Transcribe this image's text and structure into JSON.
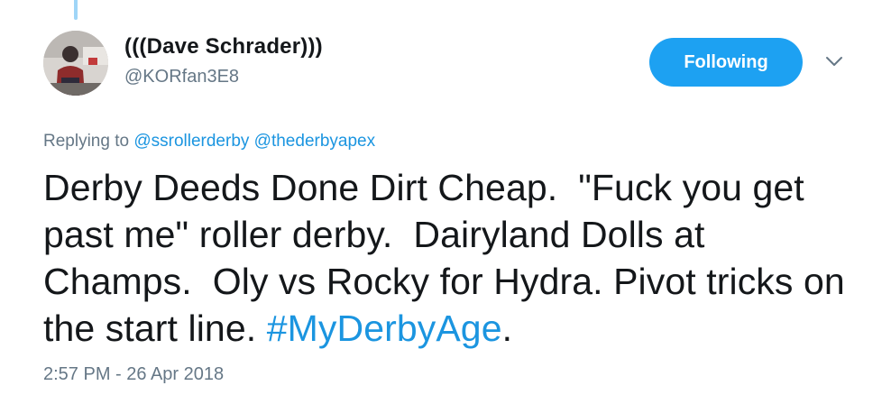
{
  "author": {
    "display_name": "(((Dave Schrader)))",
    "handle": "@KORfan3E8"
  },
  "follow_button": {
    "label": "Following"
  },
  "reply": {
    "prefix": "Replying to ",
    "mentions": [
      "@ssrollerderby",
      "@thederbyapex"
    ]
  },
  "tweet": {
    "text": "Derby Deeds Done Dirt Cheap.  \"Fuck you get past me\" roller derby.  Dairyland Dolls at Champs.  Oly vs Rocky for Hydra. Pivot tricks on the start line. ",
    "hashtag": "#MyDerbyAge",
    "suffix": "."
  },
  "timestamp": "2:57 PM - 26 Apr 2018",
  "colors": {
    "accent": "#1da1f2",
    "link": "#1b95e0",
    "secondary_text": "#657786",
    "thread_line": "#9fd5f7"
  }
}
